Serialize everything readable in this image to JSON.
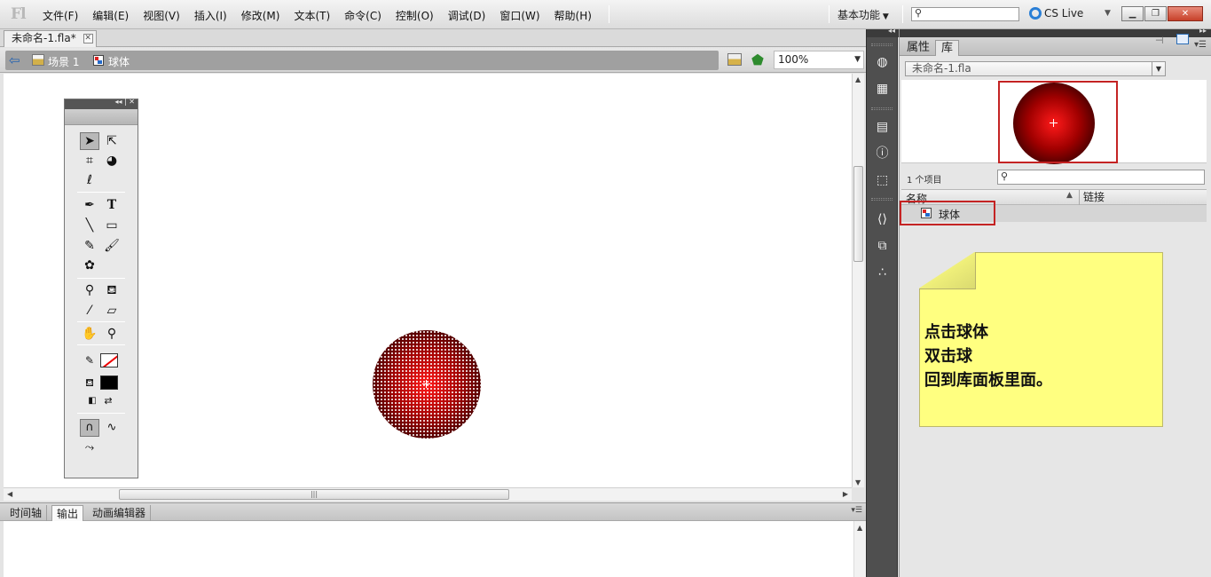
{
  "app": {
    "logo": "Fl"
  },
  "menubar": {
    "items": [
      "文件(F)",
      "编辑(E)",
      "视图(V)",
      "插入(I)",
      "修改(M)",
      "文本(T)",
      "命令(C)",
      "控制(O)",
      "调试(D)",
      "窗口(W)",
      "帮助(H)"
    ],
    "workspace_label": "基本功能",
    "search_value": "",
    "cs_live_label": "CS Live",
    "window_controls": [
      "minimize",
      "restore",
      "close"
    ]
  },
  "document": {
    "tab_title": "未命名-1.fla*",
    "breadcrumb": {
      "scene": "场景 1",
      "symbol": "球体"
    },
    "zoom": "100%"
  },
  "bottom_panel": {
    "tabs": [
      "时间轴",
      "输出",
      "动画编辑器"
    ],
    "active_tab": "输出"
  },
  "library_panel": {
    "tabs": [
      "属性",
      "库"
    ],
    "active_tab": "库",
    "document_select": "未命名-1.fla",
    "item_count": "1 个项目",
    "search_value": "",
    "columns": {
      "name": "名称",
      "linkage": "链接"
    },
    "items": [
      {
        "name": "球体",
        "type": "movie-clip"
      }
    ]
  },
  "annotation": {
    "lines": [
      "点击球体",
      "双击球",
      "回到库面板里面。"
    ],
    "background_color": "#ffff80",
    "highlight_color": "#c42323"
  },
  "tools": {
    "items": [
      "selection",
      "subselection",
      "free-transform",
      "3d-rotation",
      "lasso",
      "pen",
      "text",
      "line",
      "rectangle",
      "pencil",
      "brush",
      "deco",
      "bone",
      "paint-bucket",
      "eyedropper",
      "eraser",
      "hand",
      "zoom",
      "stroke-color",
      "fill-color",
      "swap-colors",
      "snap",
      "straighten",
      "smooth"
    ],
    "stroke_color": "none",
    "fill_color": "#000000"
  },
  "dock": {
    "icons": [
      "color-icon",
      "swatches-icon",
      "align-icon",
      "info-icon",
      "transform-icon",
      "code-snippets-icon",
      "components-icon",
      "motion-presets-icon"
    ]
  }
}
